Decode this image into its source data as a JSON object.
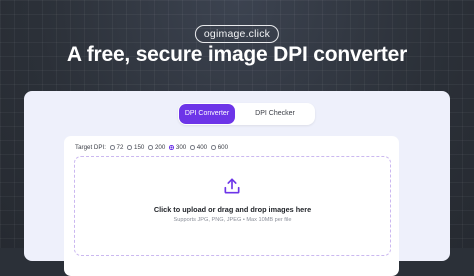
{
  "site": {
    "domain": "ogimage.click"
  },
  "hero": {
    "headline": "A free, secure image DPI converter"
  },
  "tabs": [
    {
      "label": "DPI Converter",
      "active": true
    },
    {
      "label": "DPI Checker",
      "active": false
    }
  ],
  "converter": {
    "target_label": "Target DPI:",
    "dpi_options": [
      "72",
      "150",
      "200",
      "300",
      "400",
      "600"
    ],
    "selected_dpi": "300"
  },
  "dropzone": {
    "title": "Click to upload or drag and drop images here",
    "subtitle": "Supports JPG, PNG, JPEG • Max 10MB per file",
    "icon": "upload-icon"
  },
  "colors": {
    "accent": "#6d35e8",
    "background": "#2b3038",
    "card": "#eef0fb"
  }
}
